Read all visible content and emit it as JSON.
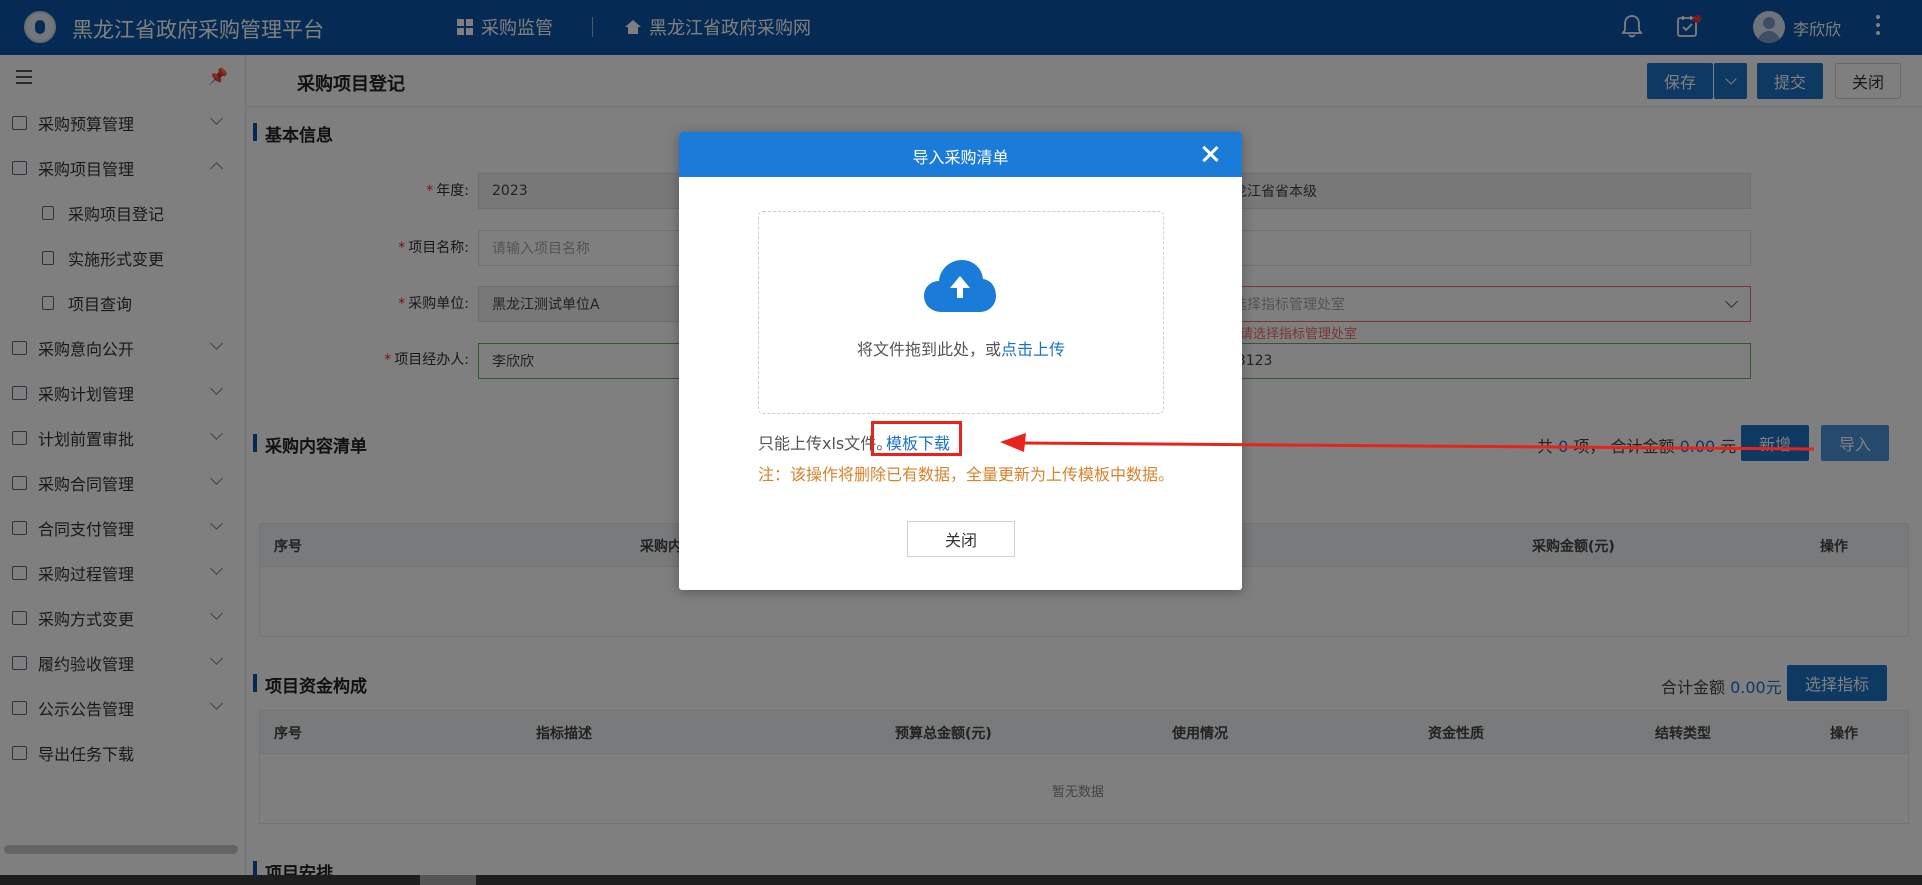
{
  "header": {
    "app_title": "黑龙江省政府采购管理平台",
    "nav": [
      {
        "label": "采购监管",
        "icon": "grid-icon"
      },
      {
        "label": "黑龙江省政府采购网",
        "icon": "home-icon"
      }
    ],
    "user_name": "李欣欣"
  },
  "sidebar": {
    "items": [
      {
        "label": "采购预算管理",
        "expanded": false
      },
      {
        "label": "采购项目管理",
        "expanded": true
      },
      {
        "label": "采购项目登记",
        "sub": true,
        "active": true
      },
      {
        "label": "实施形式变更",
        "sub": true
      },
      {
        "label": "项目查询",
        "sub": true
      },
      {
        "label": "采购意向公开",
        "expanded": false
      },
      {
        "label": "采购计划管理",
        "expanded": false
      },
      {
        "label": "计划前置审批",
        "expanded": false
      },
      {
        "label": "采购合同管理",
        "expanded": false
      },
      {
        "label": "合同支付管理",
        "expanded": false
      },
      {
        "label": "采购过程管理",
        "expanded": false
      },
      {
        "label": "采购方式变更",
        "expanded": false
      },
      {
        "label": "履约验收管理",
        "expanded": false
      },
      {
        "label": "公示公告管理",
        "expanded": false
      },
      {
        "label": "导出任务下载"
      }
    ]
  },
  "page": {
    "title": "采购项目登记",
    "buttons": {
      "save": "保存",
      "submit": "提交",
      "close": "关闭"
    },
    "basic_info": {
      "title": "基本信息",
      "year_label": "年度:",
      "year_value": "2023",
      "region_value": "黑龙江省省本级",
      "project_name_label": "项目名称:",
      "project_name_placeholder": "请输入项目名称",
      "unit_label": "采购单位:",
      "unit_value": "黑龙江测试单位A",
      "dept_placeholder": "请选择指标管理处室",
      "dept_error": "请选择指标管理处室",
      "manager_label": "项目经办人:",
      "manager_value": "李欣欣",
      "phone_value": "123123"
    },
    "content_list": {
      "title": "采购内容清单",
      "summary_prefix": "共",
      "count": "0",
      "summary_mid": "项，  合计金额",
      "amount": "0.00",
      "summary_suffix": "元",
      "add_button": "新增",
      "import_button": "导入",
      "columns": [
        "序号",
        "采购内",
        "采购金额(元)",
        "操作"
      ]
    },
    "funding": {
      "title": "项目资金构成",
      "total_label": "合计金额",
      "total_value": "0.00元",
      "select_button": "选择指标",
      "columns": [
        "序号",
        "指标描述",
        "预算总金额(元)",
        "使用情况",
        "资金性质",
        "结转类型",
        "操作"
      ],
      "empty_text": "暂无数据"
    },
    "arrangement": {
      "title": "项目安排"
    }
  },
  "dialog": {
    "title": "导入采购清单",
    "drop_text": "将文件拖到此处，或",
    "drop_link": "点击上传",
    "tip": "只能上传xls文件。",
    "template_link": "模板下载",
    "note": "注：该操作将删除已有数据，全量更新为上传模板中数据。",
    "close_button": "关闭"
  },
  "colors": {
    "header_bg": "#0a55a6",
    "primary": "#1a73c7",
    "dialog_head": "#1a7bd8",
    "warning_text": "#d9822b",
    "annotation_red": "#e8231e"
  }
}
